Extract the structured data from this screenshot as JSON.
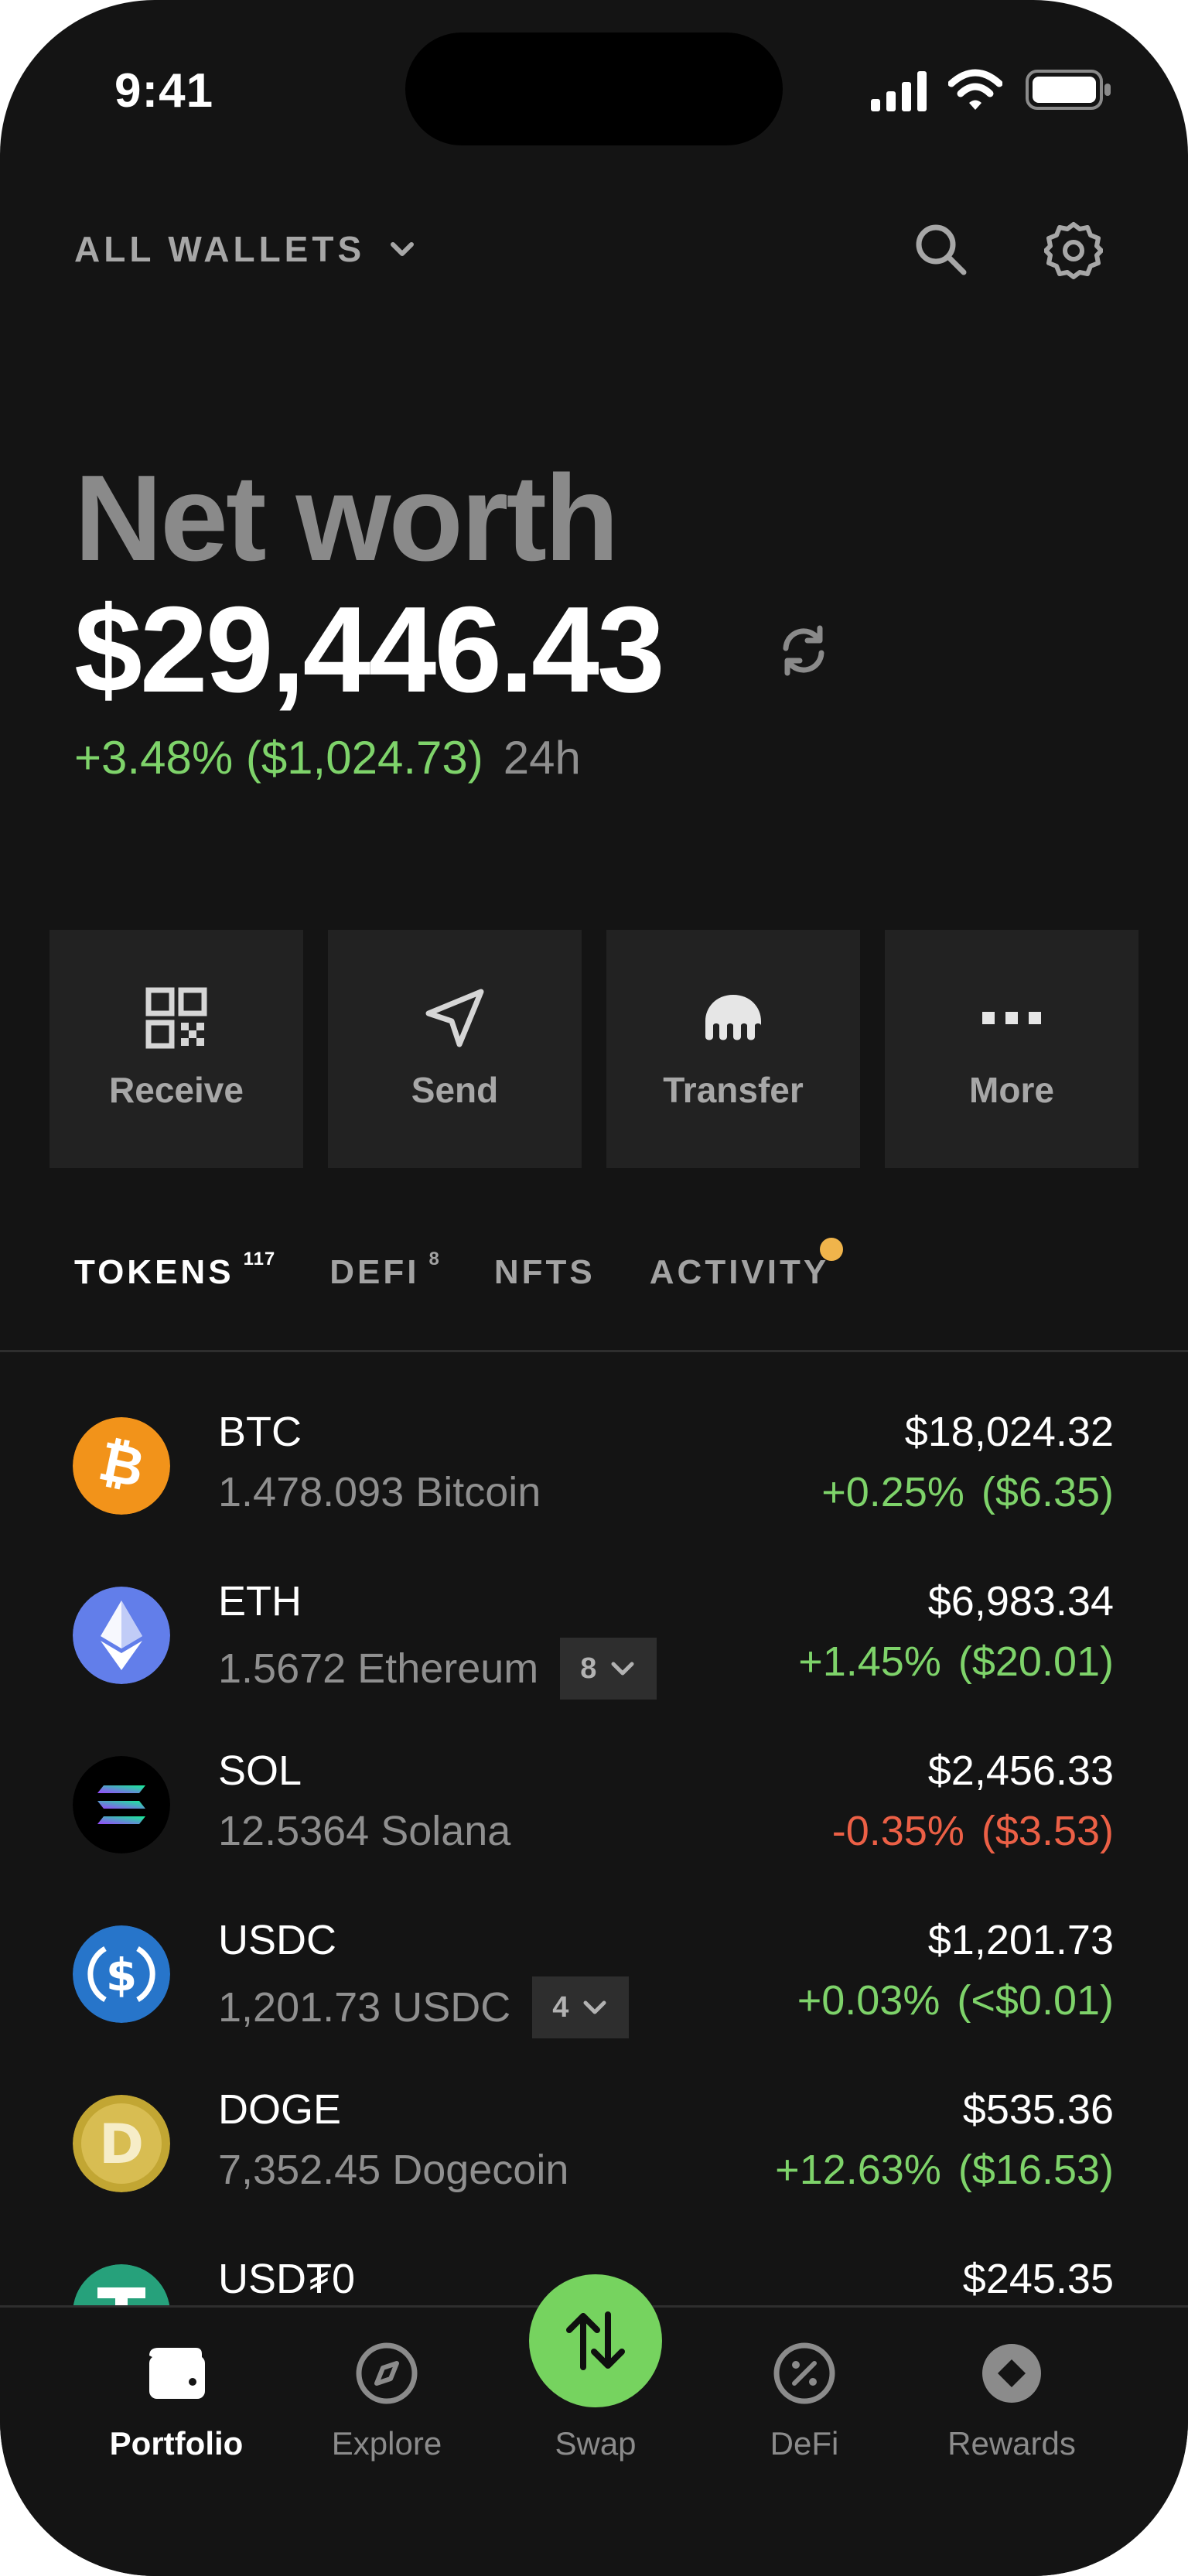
{
  "status_bar": {
    "time": "9:41"
  },
  "header": {
    "wallet_selector": "ALL WALLETS"
  },
  "net_worth": {
    "title": "Net worth",
    "value": "$29,446.43",
    "change": "+3.48% ($1,024.73)",
    "period": "24h"
  },
  "actions": [
    {
      "label": "Receive",
      "icon": "qr-code-icon"
    },
    {
      "label": "Send",
      "icon": "send-arrow-icon"
    },
    {
      "label": "Transfer",
      "icon": "kraken-logo-icon"
    },
    {
      "label": "More",
      "icon": "more-dots-icon"
    }
  ],
  "tabs": [
    {
      "label": "TOKENS",
      "count": "117",
      "active": true
    },
    {
      "label": "DEFI",
      "count": "8",
      "active": false
    },
    {
      "label": "NFTS",
      "count": "",
      "active": false
    },
    {
      "label": "ACTIVITY",
      "count": "",
      "active": false,
      "has_notification_dot": true
    }
  ],
  "tokens": [
    {
      "symbol": "BTC",
      "balance": "1.478.093 Bitcoin",
      "chains": "",
      "price": "$18,024.32",
      "change_pct": "+0.25%",
      "change_usd": "($6.35)",
      "trend": "up",
      "icon": "bitcoin-icon"
    },
    {
      "symbol": "ETH",
      "balance": "1.5672 Ethereum",
      "chains": "8",
      "price": "$6,983.34",
      "change_pct": "+1.45%",
      "change_usd": "($20.01)",
      "trend": "up",
      "icon": "ethereum-icon"
    },
    {
      "symbol": "SOL",
      "balance": "12.5364 Solana",
      "chains": "",
      "price": "$2,456.33",
      "change_pct": "-0.35%",
      "change_usd": "($3.53)",
      "trend": "down",
      "icon": "solana-icon"
    },
    {
      "symbol": "USDC",
      "balance": "1,201.73 USDC",
      "chains": "4",
      "price": "$1,201.73",
      "change_pct": "+0.03%",
      "change_usd": "(<$0.01)",
      "trend": "up",
      "icon": "usdc-icon"
    },
    {
      "symbol": "DOGE",
      "balance": "7,352.45 Dogecoin",
      "chains": "",
      "price": "$535.36",
      "change_pct": "+12.63%",
      "change_usd": "($16.53)",
      "trend": "up",
      "icon": "dogecoin-icon"
    },
    {
      "symbol": "USD₮0",
      "balance": "",
      "chains": "",
      "price": "$245.35",
      "change_pct": "",
      "change_usd": "",
      "trend": "up",
      "icon": "tether-icon"
    }
  ],
  "bottom_nav": [
    {
      "label": "Portfolio",
      "icon": "wallet-icon",
      "active": true
    },
    {
      "label": "Explore",
      "icon": "compass-icon",
      "active": false
    },
    {
      "label": "Swap",
      "icon": "swap-arrows-icon",
      "active": false
    },
    {
      "label": "DeFi",
      "icon": "percent-icon",
      "active": false
    },
    {
      "label": "Rewards",
      "icon": "rewards-icon",
      "active": false
    }
  ],
  "colors": {
    "background": "#141414",
    "positive": "#7ed36a",
    "negative": "#ec6046",
    "swap_button": "#76d35f",
    "notification": "#f0b44b"
  }
}
